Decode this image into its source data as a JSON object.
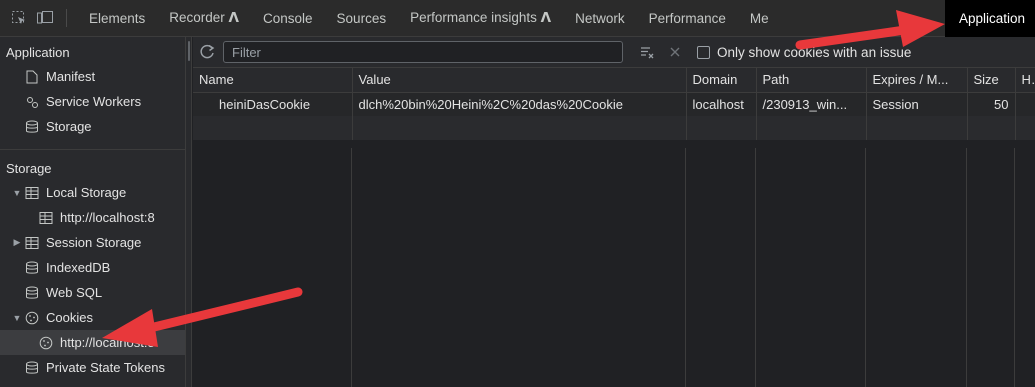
{
  "tabs": [
    "Elements",
    "Recorder 𝝠",
    "Console",
    "Sources",
    "Performance insights 𝝠",
    "Network",
    "Performance",
    "Me"
  ],
  "active_tab": "Application",
  "sidebar": {
    "app_heading": "Application",
    "app_items": [
      {
        "label": "Manifest",
        "icon": "document-icon"
      },
      {
        "label": "Service Workers",
        "icon": "gears-icon"
      },
      {
        "label": "Storage",
        "icon": "database-icon"
      }
    ],
    "storage_heading": "Storage",
    "storage_items": [
      {
        "label": "Local Storage",
        "icon": "table-icon",
        "expanded": true
      },
      {
        "label": "http://localhost:8",
        "icon": "table-icon",
        "child": true
      },
      {
        "label": "Session Storage",
        "icon": "table-icon",
        "expanded": false
      },
      {
        "label": "IndexedDB",
        "icon": "database-icon"
      },
      {
        "label": "Web SQL",
        "icon": "database-icon"
      },
      {
        "label": "Cookies",
        "icon": "cookie-icon",
        "expanded": true
      },
      {
        "label": "http://localhost:8",
        "icon": "cookie-icon",
        "child": true,
        "selected": true
      },
      {
        "label": "Private State Tokens",
        "icon": "database-icon"
      }
    ]
  },
  "toolbar": {
    "filter_placeholder": "Filter",
    "only_issue_label": "Only show cookies with an issue"
  },
  "table": {
    "columns": [
      "Name",
      "Value",
      "Domain",
      "Path",
      "Expires / M...",
      "Size",
      "H"
    ],
    "rows": [
      [
        "heiniDasCookie",
        "dlch%20bin%20Heini%2C%20das%20Cookie",
        "localhost",
        "/230913_win...",
        "Session",
        "50",
        ""
      ]
    ]
  },
  "colors": {
    "annotation_arrow": "#e8383b",
    "accent": "#8ab4f8"
  }
}
